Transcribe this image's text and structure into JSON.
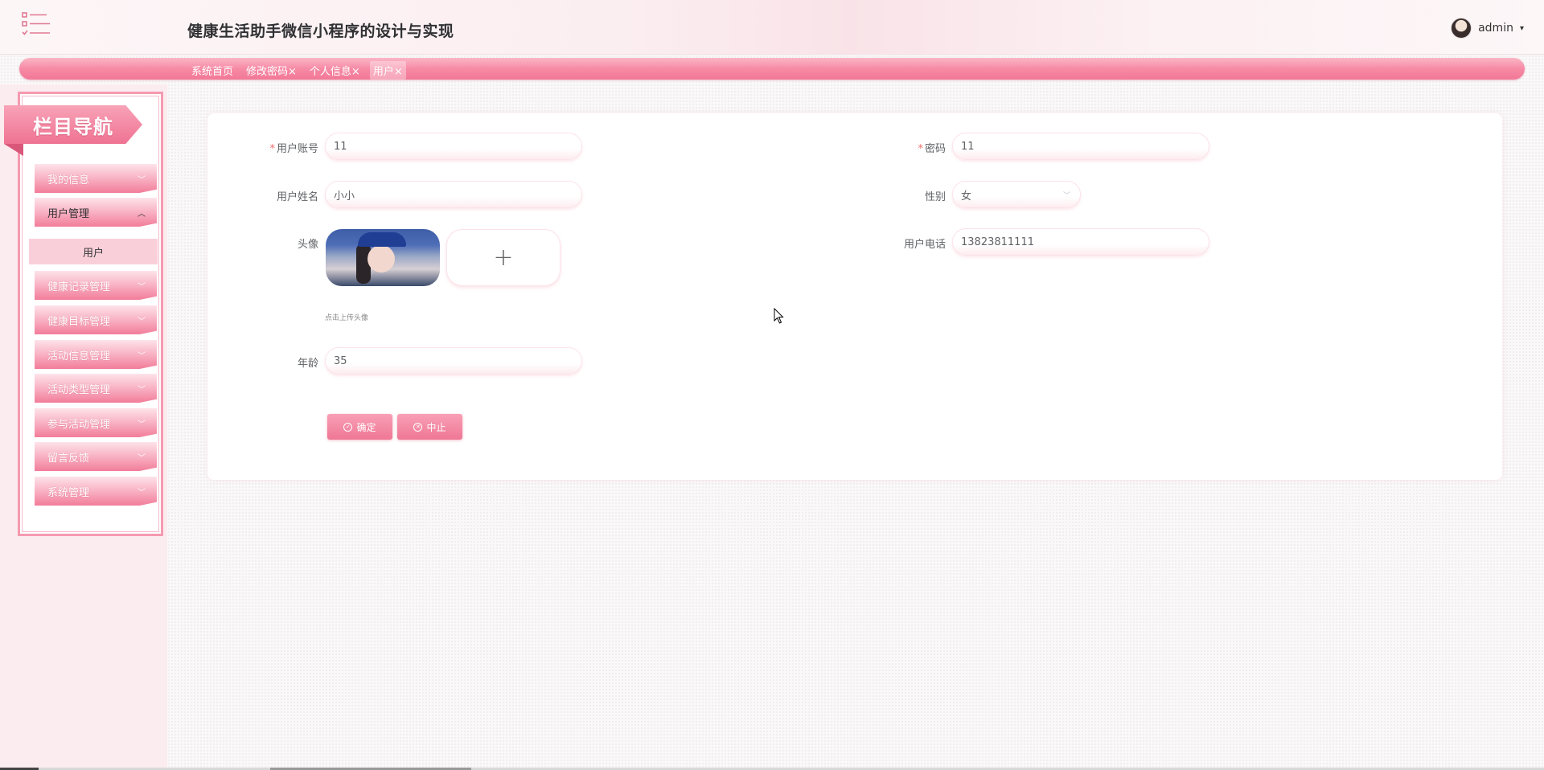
{
  "header": {
    "title": "健康生活助手微信小程序的设计与实现",
    "user": "admin",
    "menu_icon": "list-menu-icon",
    "caret": "▾"
  },
  "tabs": [
    {
      "label": "系统首页"
    },
    {
      "label": "修改密码×"
    },
    {
      "label": "个人信息×"
    },
    {
      "label": "用户×",
      "active": true
    }
  ],
  "sidebar": {
    "banner": "栏目导航",
    "items": [
      {
        "label": "我的信息",
        "chev": "﹀"
      },
      {
        "label": "用户管理",
        "chev": "︿",
        "open": true
      },
      {
        "label": "健康记录管理",
        "chev": "﹀"
      },
      {
        "label": "健康目标管理",
        "chev": "﹀"
      },
      {
        "label": "活动信息管理",
        "chev": "﹀"
      },
      {
        "label": "活动类型管理",
        "chev": "﹀"
      },
      {
        "label": "参与活动管理",
        "chev": "﹀"
      },
      {
        "label": "留言反馈",
        "chev": "﹀"
      },
      {
        "label": "系统管理",
        "chev": "﹀"
      }
    ],
    "submenu": {
      "label": "用户"
    }
  },
  "form": {
    "account": {
      "label": "用户账号",
      "required": "*",
      "value": "11"
    },
    "password": {
      "label": "密码",
      "required": "*",
      "value": "11"
    },
    "name": {
      "label": "用户姓名",
      "value": "小小"
    },
    "gender": {
      "label": "性别",
      "value": "女",
      "chev": "﹀"
    },
    "avatar": {
      "label": "头像",
      "add": "+",
      "tip": "点击上传头像"
    },
    "phone": {
      "label": "用户电话",
      "value": "13823811111"
    },
    "age": {
      "label": "年龄",
      "value": "35"
    },
    "buttons": {
      "confirm": {
        "label": "确定",
        "icon": "✓"
      },
      "cancel": {
        "label": "中止",
        "icon": "✕"
      }
    }
  },
  "colors": {
    "accent": "#ef7796",
    "accent_light": "#f9d0da",
    "required": "#f56c6c"
  }
}
